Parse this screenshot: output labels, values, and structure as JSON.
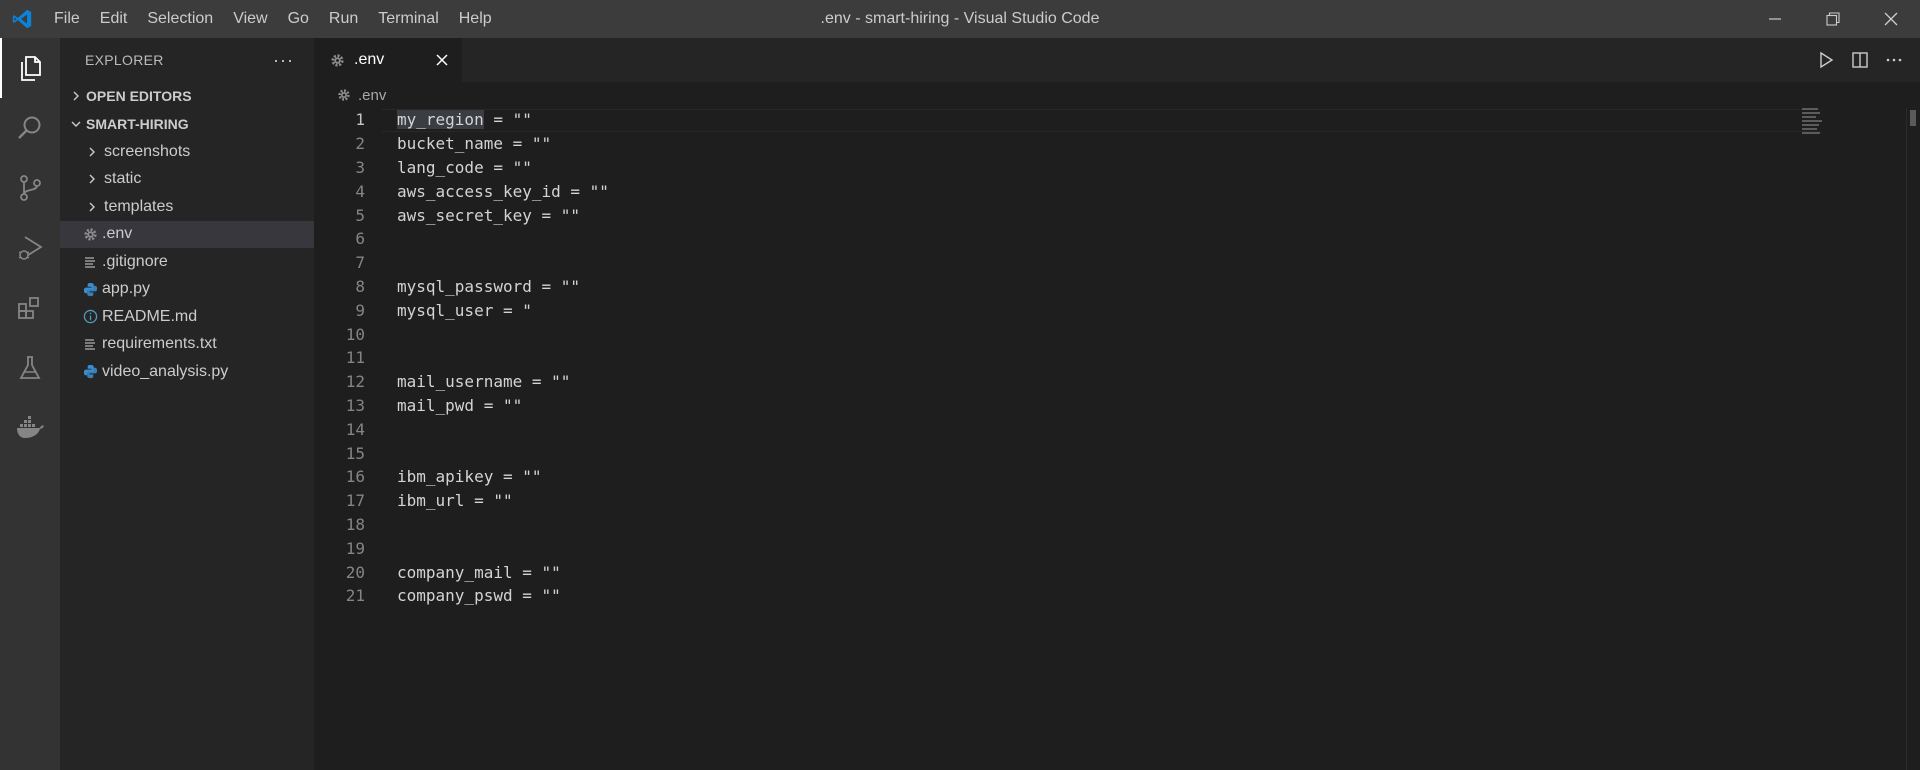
{
  "titlebar": {
    "menu": [
      "File",
      "Edit",
      "Selection",
      "View",
      "Go",
      "Run",
      "Terminal",
      "Help"
    ],
    "title": ".env - smart-hiring - Visual Studio Code",
    "accent": "#0a84d8"
  },
  "activity_bar": {
    "items": [
      "explorer-icon",
      "search-icon",
      "source-control-icon",
      "run-debug-icon",
      "extensions-icon",
      "testing-icon",
      "docker-icon"
    ]
  },
  "sidebar": {
    "title": "EXPLORER",
    "more": "···",
    "open_editors": "OPEN EDITORS",
    "project": "SMART-HIRING",
    "folders": [
      "screenshots",
      "static",
      "templates"
    ],
    "files": [
      {
        "name": ".env",
        "icon": "gear-icon",
        "selected": true
      },
      {
        "name": ".gitignore",
        "icon": "lines-icon"
      },
      {
        "name": "app.py",
        "icon": "python-icon"
      },
      {
        "name": "README.md",
        "icon": "info-icon"
      },
      {
        "name": "requirements.txt",
        "icon": "lines-icon"
      },
      {
        "name": "video_analysis.py",
        "icon": "python-icon"
      }
    ]
  },
  "editor": {
    "tab_label": ".env",
    "breadcrumb": ".env",
    "lines": [
      {
        "n": "1",
        "text": "my_region = \"\""
      },
      {
        "n": "2",
        "text": "bucket_name = \"\""
      },
      {
        "n": "3",
        "text": "lang_code = \"\""
      },
      {
        "n": "4",
        "text": "aws_access_key_id = \"\""
      },
      {
        "n": "5",
        "text": "aws_secret_key = \"\""
      },
      {
        "n": "6",
        "text": ""
      },
      {
        "n": "7",
        "text": ""
      },
      {
        "n": "8",
        "text": "mysql_password = \"\""
      },
      {
        "n": "9",
        "text": "mysql_user = \""
      },
      {
        "n": "10",
        "text": ""
      },
      {
        "n": "11",
        "text": ""
      },
      {
        "n": "12",
        "text": "mail_username = \"\""
      },
      {
        "n": "13",
        "text": "mail_pwd = \"\""
      },
      {
        "n": "14",
        "text": ""
      },
      {
        "n": "15",
        "text": ""
      },
      {
        "n": "16",
        "text": "ibm_apikey = \"\""
      },
      {
        "n": "17",
        "text": "ibm_url = \"\""
      },
      {
        "n": "18",
        "text": ""
      },
      {
        "n": "19",
        "text": ""
      },
      {
        "n": "20",
        "text": "company_mail = \"\""
      },
      {
        "n": "21",
        "text": "company_pswd = \"\""
      }
    ]
  }
}
